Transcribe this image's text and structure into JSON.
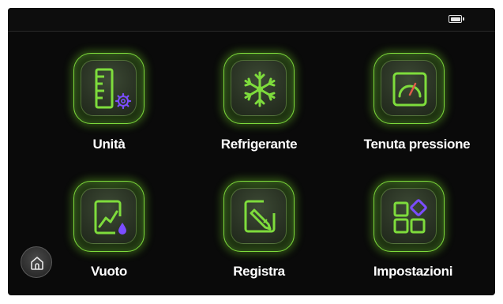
{
  "status_bar": {
    "battery_icon": "battery-icon"
  },
  "menu": {
    "items": [
      {
        "label": "Unità",
        "icon": "ruler-gear-icon"
      },
      {
        "label": "Refrigerante",
        "icon": "snowflake-icon"
      },
      {
        "label": "Tenuta pressione",
        "icon": "gauge-icon"
      },
      {
        "label": "Vuoto",
        "icon": "chart-drop-icon"
      },
      {
        "label": "Registra",
        "icon": "pencil-square-icon"
      },
      {
        "label": "Impostazioni",
        "icon": "apps-grid-icon"
      }
    ]
  },
  "home": {
    "icon": "home-icon"
  },
  "colors": {
    "accent_green": "#7edc3c",
    "accent_purple": "#7b4dff",
    "background": "#0a0a0a"
  }
}
